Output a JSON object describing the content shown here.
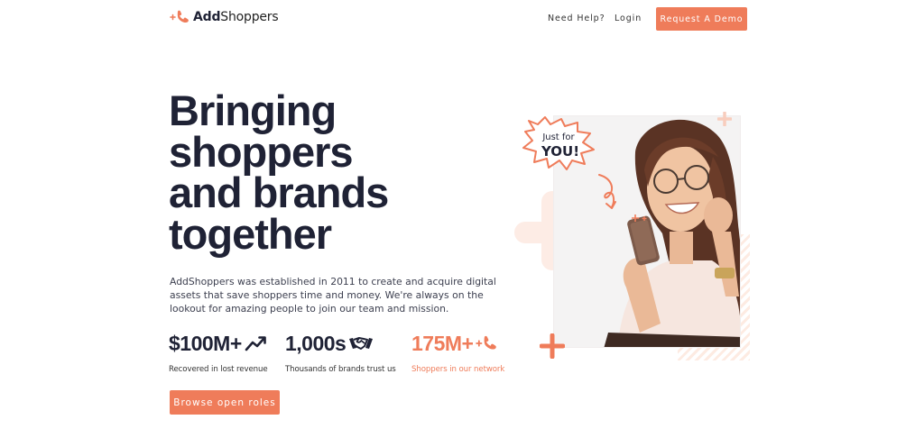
{
  "header": {
    "logo_add": "Add",
    "logo_shoppers": "Shoppers",
    "nav_help": "Need Help?",
    "nav_login": "Login",
    "demo_button": "Request A Demo"
  },
  "hero": {
    "title_lines": [
      "Bringing",
      "shoppers",
      "and brands",
      "together"
    ],
    "intro": "AddShoppers was established in 2011 to create and acquire digital assets that save shoppers time and money. We're always on the lookout for amazing people to join our team and mission."
  },
  "stats": [
    {
      "value": "$100M+",
      "label": "Recovered in lost revenue",
      "icon": "trend-up-icon"
    },
    {
      "value": "1,000s",
      "label": "Thousands of brands trust us",
      "icon": "handshake-icon"
    },
    {
      "value": "175M+",
      "label": "Shoppers in our network",
      "icon": "addshoppers-mark-icon"
    }
  ],
  "cta": {
    "browse_label": "Browse open roles"
  },
  "visual": {
    "sticker_line1": "Just for",
    "sticker_line2": "YOU!"
  },
  "colors": {
    "accent": "#ef7c5a",
    "heading": "#1f2235",
    "accent_light": "#fde6dc"
  }
}
